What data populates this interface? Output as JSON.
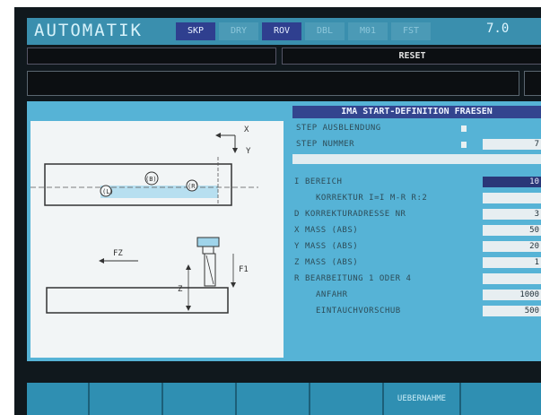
{
  "header": {
    "title": "AUTOMATIK",
    "modes": [
      {
        "label": "SKP",
        "active": true
      },
      {
        "label": "DRY",
        "active": false
      },
      {
        "label": "ROV",
        "active": true
      },
      {
        "label": "DBL",
        "active": false
      },
      {
        "label": "M01",
        "active": false
      },
      {
        "label": "FST",
        "active": false
      }
    ],
    "value": "7.0"
  },
  "status": {
    "reset_label": "RESET"
  },
  "panel": {
    "title": "IMA START-DEFINITION FRAESEN",
    "options": [
      {
        "label": "STEP AUSBLENDUNG"
      },
      {
        "label": "STEP NUMMER",
        "value": "7"
      }
    ],
    "rows": [
      {
        "code": "I",
        "label": "BEREICH",
        "value": "10"
      },
      {
        "code": "",
        "label": "KORREKTUR I=I M-R R:2",
        "value": ""
      },
      {
        "code": "D",
        "label": "KORREKTURADRESSE NR",
        "value": "3"
      },
      {
        "code": "X",
        "label": "MASS (ABS)",
        "value": "50"
      },
      {
        "code": "Y",
        "label": "MASS (ABS)",
        "value": "20"
      },
      {
        "code": "Z",
        "label": "MASS (ABS)",
        "value": "1"
      },
      {
        "code": "R",
        "label": "BEARBEITUNG 1 ODER 4",
        "value": ""
      },
      {
        "code": "",
        "label": "ANFAHR",
        "value": "1000"
      },
      {
        "code": "",
        "label": "EINTAUCHVORSCHUB",
        "value": "500"
      }
    ],
    "diagram": {
      "axis_x": "X",
      "axis_y": "Y",
      "point_b": "(B)",
      "point_r": "(R)",
      "point_l": "(L)",
      "fz": "FZ",
      "z": "Z",
      "f1": "F1"
    }
  },
  "softkeys": [
    {
      "label": ""
    },
    {
      "label": ""
    },
    {
      "label": ""
    },
    {
      "label": ""
    },
    {
      "label": ""
    },
    {
      "label": "UEBERNAHME"
    },
    {
      "label": ""
    }
  ],
  "colors": {
    "panel_bg": "#56b3d6",
    "title_bar": "#33458f",
    "highlight": "#2a3778",
    "screen_bg": "#10181d"
  }
}
